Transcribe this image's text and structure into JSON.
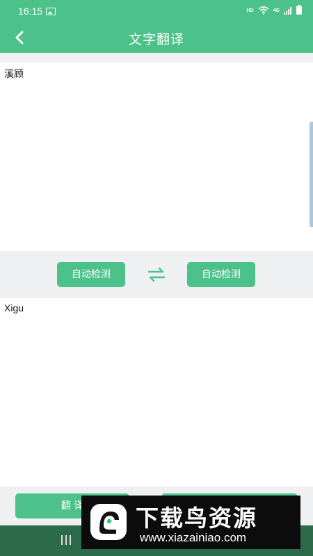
{
  "status_bar": {
    "time": "16:15",
    "hd_label": "HD",
    "network_label": "4G",
    "icons": [
      "image-icon",
      "wifi-icon",
      "signal-icon",
      "battery-icon"
    ]
  },
  "header": {
    "title": "文字翻译",
    "back_icon": "chevron-left-icon",
    "color": "#4cc28a"
  },
  "input": {
    "text": "溪顾"
  },
  "language_bar": {
    "source_label": "自动检测",
    "target_label": "自动检测",
    "swap_icon": "swap-arrows-icon"
  },
  "output": {
    "text": "Xigu"
  },
  "actions": {
    "translate_label": "翻 译"
  },
  "watermark": {
    "title": "下载鸟资源",
    "url": "www.xiazainiao.com"
  },
  "colors": {
    "accent": "#4cc28a",
    "background": "#eef0f2",
    "nav_bar": "#2b6b4b"
  }
}
